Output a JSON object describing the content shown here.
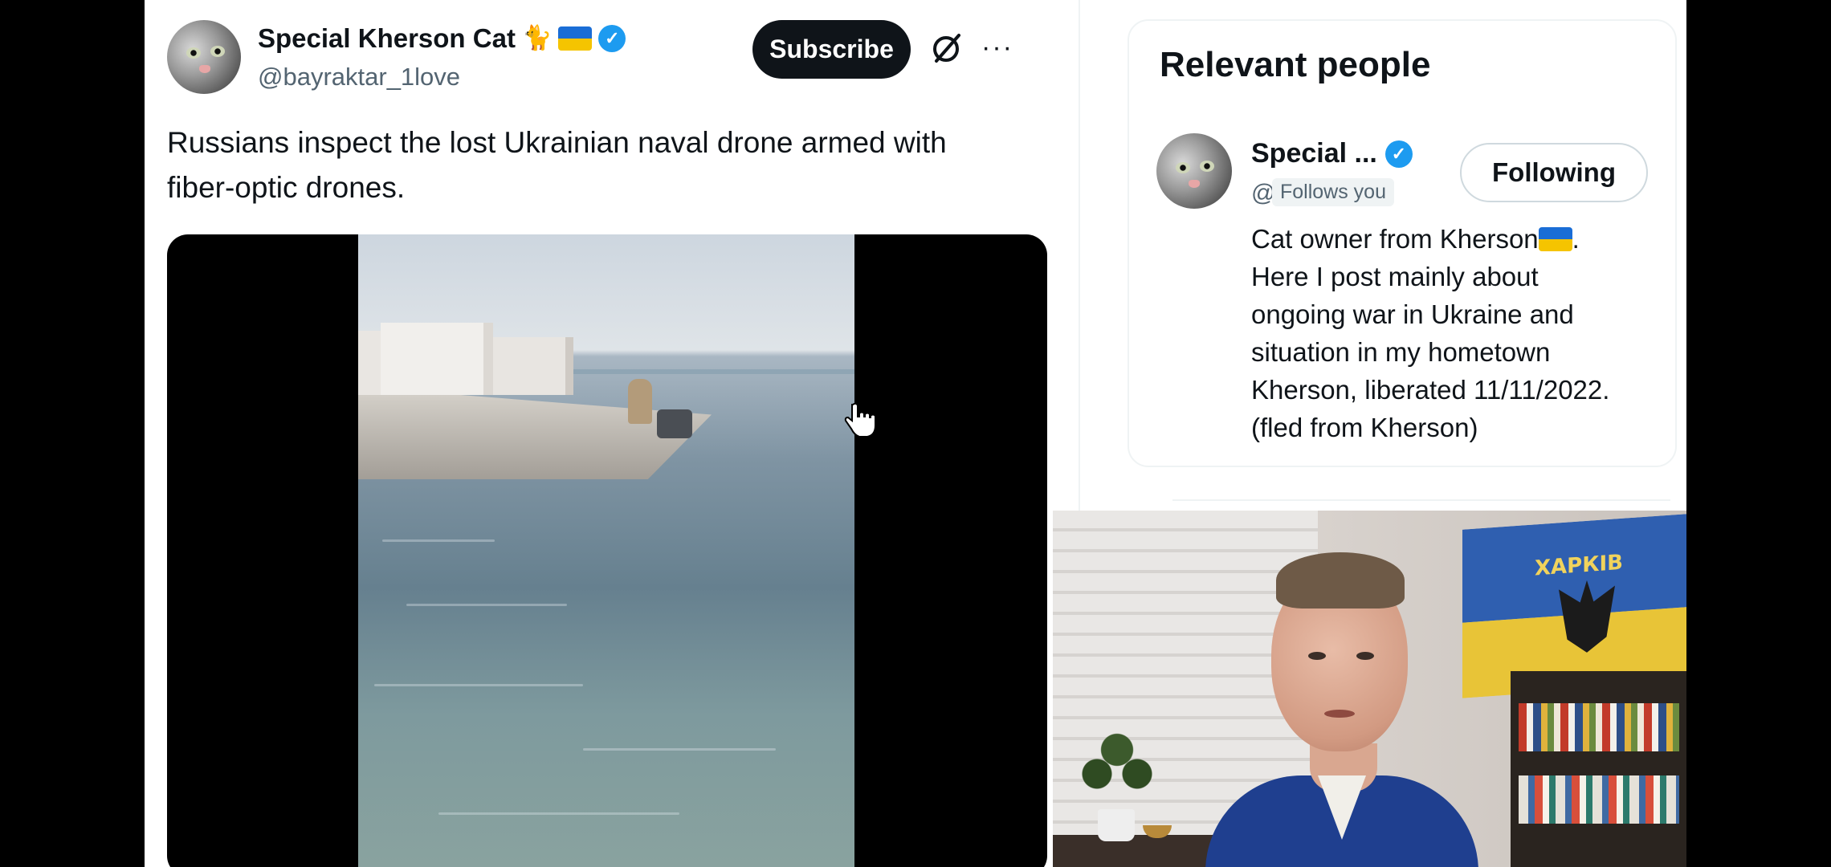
{
  "tweet": {
    "author": {
      "display_name": "Special Kherson Cat",
      "name_emoji": "🐈",
      "verified": true,
      "handle": "@bayraktar_1love"
    },
    "subscribe_label": "Subscribe",
    "text": "Russians inspect the lost Ukrainian naval drone armed with fiber-optic drones."
  },
  "sidebar": {
    "relevant_people": {
      "title": "Relevant people",
      "person": {
        "name": "Special ...",
        "handle": "@...",
        "follows_badge": "Follows you",
        "button_label": "Following",
        "bio_lines": [
          "Cat owner from Kherson",
          "Here I post mainly about",
          "ongoing war in Ukraine and",
          "situation in my hometown",
          "Kherson, liberated 11/11/2022.",
          "(fled from Kherson)"
        ],
        "bio_line1_suffix": "."
      }
    }
  },
  "webcam": {
    "flag_text": "ХАРКІВ"
  },
  "colors": {
    "accent_blue": "#1d9bf0",
    "text_primary": "#0f1419",
    "text_secondary": "#536471",
    "button_dark": "#0f1419"
  },
  "icons": [
    "verified-icon",
    "grok-icon",
    "more-icon",
    "cursor-hand-icon"
  ]
}
